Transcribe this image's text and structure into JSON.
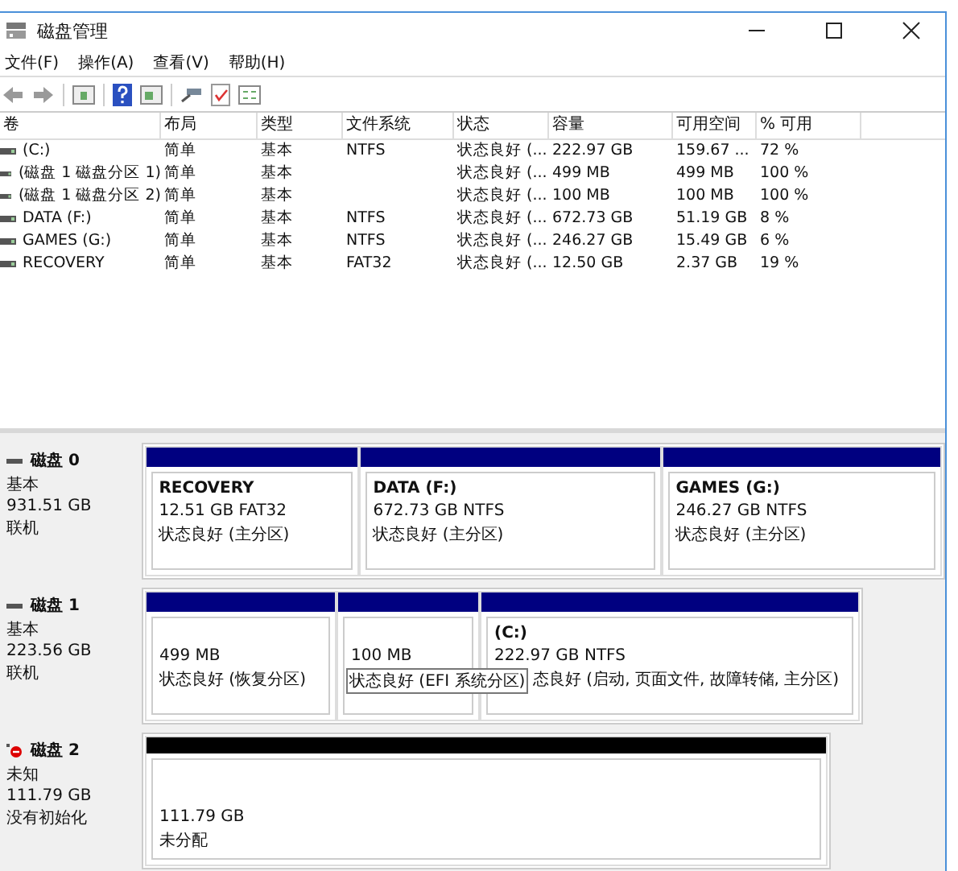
{
  "window": {
    "title": "磁盘管理"
  },
  "menu": [
    "文件(F)",
    "操作(A)",
    "查看(V)",
    "帮助(H)"
  ],
  "table": {
    "columns": [
      "卷",
      "布局",
      "类型",
      "文件系统",
      "状态",
      "容量",
      "可用空间",
      "% 可用"
    ],
    "rows": [
      [
        "(C:)",
        "简单",
        "基本",
        "NTFS",
        "状态良好 (...",
        "222.97 GB",
        "159.67 ...",
        "72 %"
      ],
      [
        "(磁盘 1 磁盘分区 1)",
        "简单",
        "基本",
        "",
        "状态良好 (...",
        "499 MB",
        "499 MB",
        "100 %"
      ],
      [
        "(磁盘 1 磁盘分区 2)",
        "简单",
        "基本",
        "",
        "状态良好 (...",
        "100 MB",
        "100 MB",
        "100 %"
      ],
      [
        "DATA (F:)",
        "简单",
        "基本",
        "NTFS",
        "状态良好 (...",
        "672.73 GB",
        "51.19 GB",
        "8 %"
      ],
      [
        "GAMES (G:)",
        "简单",
        "基本",
        "NTFS",
        "状态良好 (...",
        "246.27 GB",
        "15.49 GB",
        "6 %"
      ],
      [
        "RECOVERY",
        "简单",
        "基本",
        "FAT32",
        "状态良好 (...",
        "12.50 GB",
        "2.37 GB",
        "19 %"
      ]
    ]
  },
  "disks": [
    {
      "name": "磁盘 0",
      "error": false,
      "type": "基本",
      "size": "931.51 GB",
      "status": "联机",
      "partitions": [
        {
          "kind": "primary",
          "label": "RECOVERY",
          "size": "12.51 GB FAT32",
          "status": "状态良好 (主分区)"
        },
        {
          "kind": "primary",
          "label": "DATA  (F:)",
          "size": "672.73 GB NTFS",
          "status": "状态良好 (主分区)"
        },
        {
          "kind": "primary",
          "label": "GAMES  (G:)",
          "size": "246.27 GB NTFS",
          "status": "状态良好 (主分区)"
        }
      ]
    },
    {
      "name": "磁盘 1",
      "error": false,
      "type": "基本",
      "size": "223.56 GB",
      "status": "联机",
      "partitions": [
        {
          "kind": "primary",
          "size": "499 MB",
          "status": "状态良好 (恢复分区)"
        },
        {
          "kind": "primary",
          "size": "100 MB",
          "status": "状态良好 (EFI 系统分区)",
          "tip": true
        },
        {
          "kind": "primary",
          "label": "(C:)",
          "size": "222.97 GB NTFS",
          "status": "态良好 (启动, 页面文件, 故障转储, 主分区)"
        }
      ]
    },
    {
      "name": "磁盘 2",
      "error": true,
      "type": "未知",
      "size": "111.79 GB",
      "status": "没有初始化",
      "partitions": [
        {
          "kind": "unallocated",
          "size": "111.79 GB",
          "status": "未分配"
        }
      ]
    }
  ]
}
